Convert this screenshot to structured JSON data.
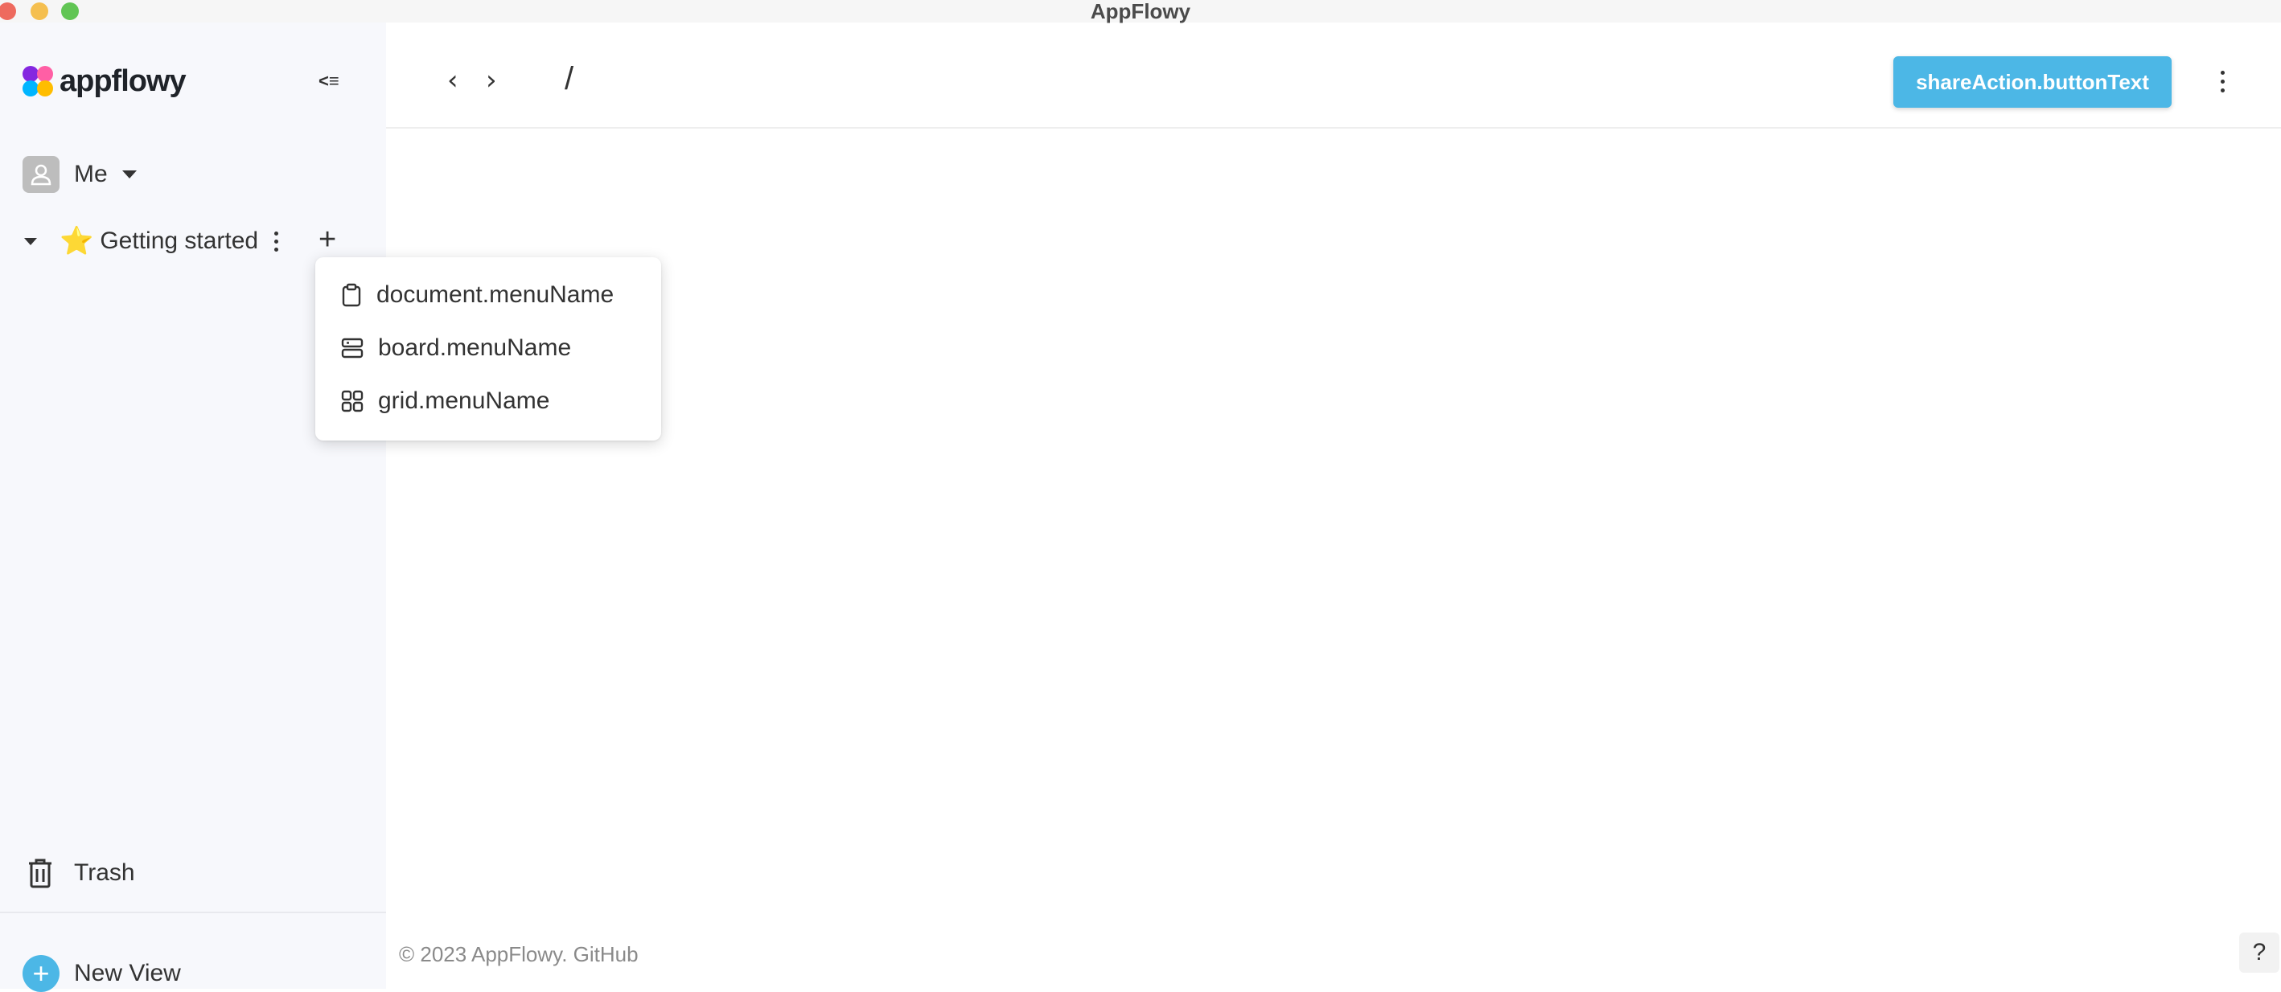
{
  "window": {
    "title": "AppFlowy"
  },
  "sidebar": {
    "logo_text": "appflowy",
    "user": {
      "name": "Me"
    },
    "workspace": {
      "emoji": "⭐",
      "name": "Getting started"
    },
    "trash_label": "Trash",
    "new_view_label": "New View"
  },
  "header": {
    "breadcrumb_separator": "/",
    "share_button": "shareAction.buttonText"
  },
  "popup_menu": {
    "items": [
      {
        "label": "document.menuName",
        "icon": "document-icon"
      },
      {
        "label": "board.menuName",
        "icon": "board-icon"
      },
      {
        "label": "grid.menuName",
        "icon": "grid-icon"
      }
    ]
  },
  "footer": {
    "copyright": "© 2023 AppFlowy. GitHub",
    "help_label": "?"
  },
  "colors": {
    "accent": "#4cb7e6",
    "sidebar_bg": "#f7f8fc",
    "text": "#333333"
  }
}
